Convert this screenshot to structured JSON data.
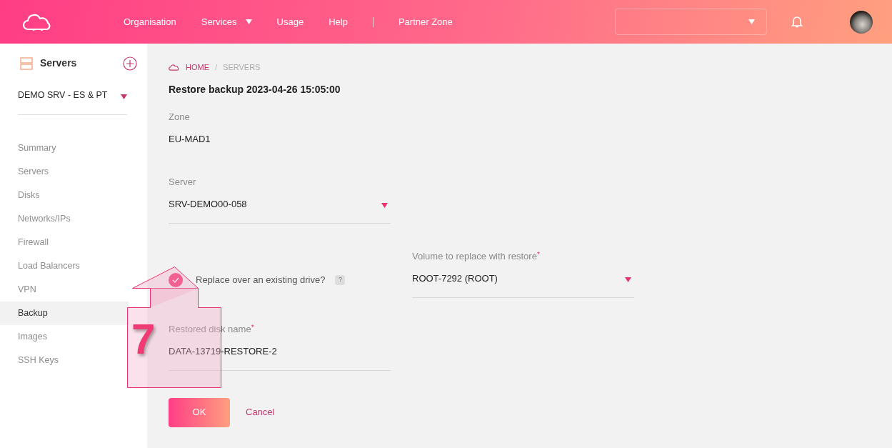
{
  "header": {
    "nav": [
      {
        "label": "Organisation",
        "has_menu": false
      },
      {
        "label": "Services",
        "has_menu": true
      },
      {
        "label": "Usage",
        "has_menu": false
      },
      {
        "label": "Help",
        "has_menu": false
      },
      {
        "label": "Partner Zone",
        "has_menu": false
      }
    ]
  },
  "sidebar": {
    "title": "Servers",
    "project": "DEMO SRV - ES & PT",
    "items": [
      {
        "label": "Summary",
        "selected": false
      },
      {
        "label": "Servers",
        "selected": false
      },
      {
        "label": "Disks",
        "selected": false
      },
      {
        "label": "Networks/IPs",
        "selected": false
      },
      {
        "label": "Firewall",
        "selected": false
      },
      {
        "label": "Load Balancers",
        "selected": false
      },
      {
        "label": "VPN",
        "selected": false
      },
      {
        "label": "Backup",
        "selected": true
      },
      {
        "label": "Images",
        "selected": false
      },
      {
        "label": "SSH Keys",
        "selected": false
      }
    ]
  },
  "breadcrumb": {
    "items": [
      "HOME",
      "SERVERS"
    ],
    "separator": "/"
  },
  "title": "Restore backup 2023-04-26 15:05:00",
  "zone": {
    "label": "Zone",
    "value": "EU-MAD1"
  },
  "server": {
    "label": "Server",
    "value": "SRV-DEMO00-058"
  },
  "replace": {
    "label": "Replace over an existing drive?",
    "checked": true,
    "help": "?"
  },
  "volume": {
    "label": "Volume to replace with restore",
    "required_mark": "*",
    "value": "ROOT-7292 (ROOT)"
  },
  "disk_name": {
    "label": "Restored disk name",
    "required_mark": "*",
    "value": "DATA-13719-RESTORE-2"
  },
  "buttons": {
    "ok": "OK",
    "cancel": "Cancel"
  },
  "annotation": {
    "step": "7"
  }
}
